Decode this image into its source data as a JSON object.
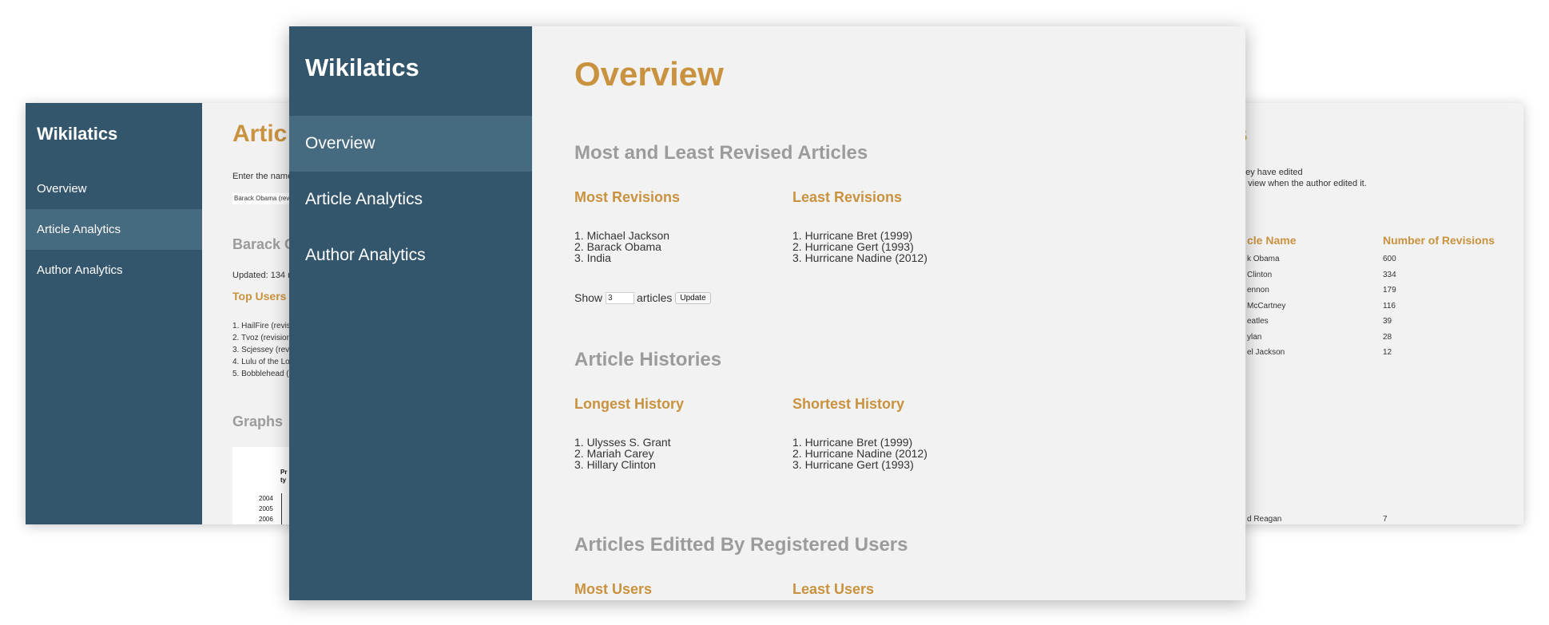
{
  "app": {
    "brand": "Wikilatics"
  },
  "nav": [
    "Overview",
    "Article Analytics",
    "Author Analytics"
  ],
  "left_window": {
    "page_title": "Artic",
    "search_prompt": "Enter the name",
    "search_value": "Barack Obama (revis",
    "article_heading": "Barack O",
    "updated_text": "Updated: 134 re",
    "top_users_heading": "Top Users",
    "top_users": [
      "1. HailFire (revisi",
      "2. Tvoz (revision",
      "3. Scjessey (revis",
      "4. Lulu of the Lo",
      "5. Bobblehead ("
    ],
    "graphs_heading": "Graphs",
    "graph": {
      "title_lines": [
        "Pr",
        "ty"
      ],
      "y_ticks": [
        "2004",
        "2005",
        "2006"
      ]
    }
  },
  "right_window": {
    "page_title": "s",
    "instructions": [
      "hey have edited",
      "o view when the author edited it."
    ],
    "table": {
      "headers": [
        "cle Name",
        "Number of Revisions"
      ],
      "rows": [
        [
          "k Obama",
          "600"
        ],
        [
          "Clinton",
          "334"
        ],
        [
          "ennon",
          "179"
        ],
        [
          "McCartney",
          "116"
        ],
        [
          "eatles",
          "39"
        ],
        [
          "ylan",
          "28"
        ],
        [
          "el Jackson",
          "12"
        ]
      ],
      "last_row": [
        "d Reagan",
        "7"
      ]
    }
  },
  "front_window": {
    "page_title": "Overview",
    "sections": [
      {
        "title": "Most and Least Revised Articles",
        "columns": [
          {
            "heading": "Most Revisions",
            "items": [
              "1. Michael Jackson",
              "2. Barack Obama",
              "3. India"
            ]
          },
          {
            "heading": "Least Revisions",
            "items": [
              "1. Hurricane Bret (1999)",
              "2. Hurricane Gert (1993)",
              "3. Hurricane Nadine (2012)"
            ]
          }
        ],
        "show_control": {
          "prefix": "Show",
          "value": "3",
          "suffix": "articles",
          "button": "Update"
        }
      },
      {
        "title": "Article Histories",
        "columns": [
          {
            "heading": "Longest History",
            "items": [
              "1. Ulysses S. Grant",
              "2. Mariah Carey",
              "3. Hillary Clinton"
            ]
          },
          {
            "heading": "Shortest History",
            "items": [
              "1. Hurricane Bret (1999)",
              "2. Hurricane Nadine (2012)",
              "3. Hurricane Gert (1993)"
            ]
          }
        ]
      },
      {
        "title": "Articles Editted By Registered Users",
        "columns": [
          {
            "heading": "Most Users"
          },
          {
            "heading": "Least Users"
          }
        ]
      }
    ]
  },
  "colors": {
    "sidebar": "#33566c",
    "sidebar_active": "#466a80",
    "accent": "#c9923e",
    "section_grey": "#9b9b9b",
    "content_bg": "#f2f2f2"
  }
}
